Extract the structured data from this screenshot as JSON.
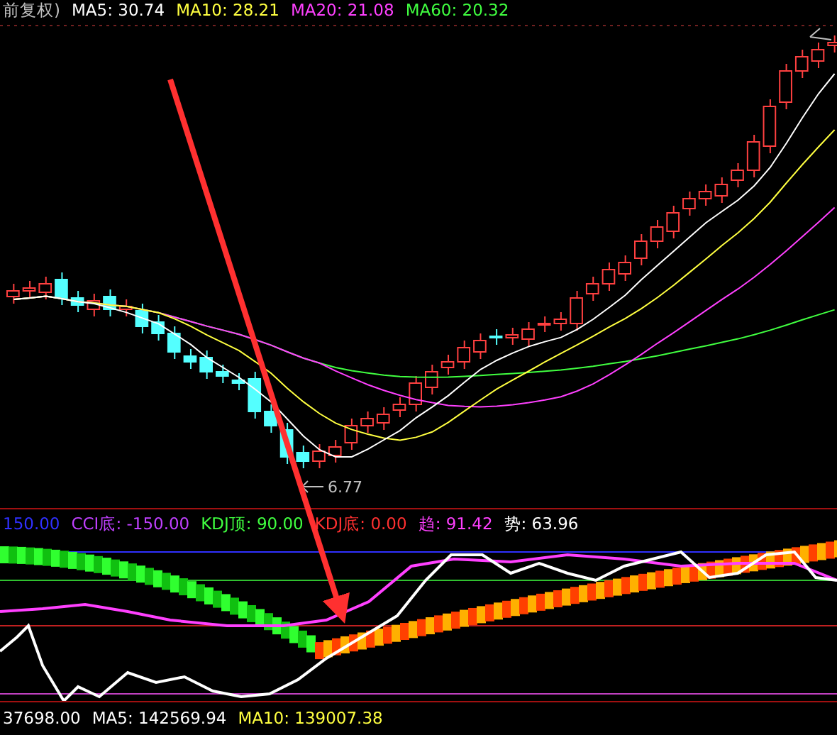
{
  "main_chart": {
    "legend": [
      {
        "text": "前复权)",
        "color": "#c0c0c0"
      },
      {
        "text": "MA5: 30.74",
        "color": "#ffffff"
      },
      {
        "text": "MA10: 28.21",
        "color": "#ffff40"
      },
      {
        "text": "MA20: 21.08",
        "color": "#ff40ff"
      },
      {
        "text": "MA60: 20.32",
        "color": "#40ff40"
      }
    ],
    "low_label": "6.77"
  },
  "indicator": {
    "legend": [
      {
        "text": "150.00",
        "color": "#3030ff"
      },
      {
        "text": "CCI底: -150.00",
        "color": "#c040ff"
      },
      {
        "text": "KDJ顶: 90.00",
        "color": "#40ff40"
      },
      {
        "text": "KDJ底: 0.00",
        "color": "#ff3030"
      },
      {
        "text": "趋: 91.42",
        "color": "#ff40ff"
      },
      {
        "text": "势: 63.96",
        "color": "#ffffff"
      }
    ]
  },
  "volume": {
    "legend": [
      {
        "text": "37698.00",
        "color": "#ffffff"
      },
      {
        "text": "MA5: 142569.94",
        "color": "#ffffff"
      },
      {
        "text": "MA10: 139007.38",
        "color": "#ffff40"
      }
    ]
  }
}
